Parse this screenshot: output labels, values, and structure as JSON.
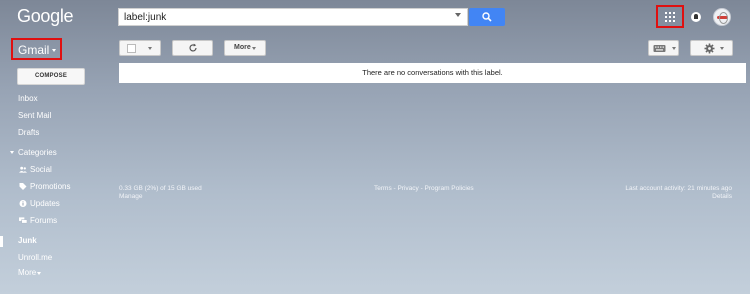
{
  "header": {
    "logo": "Google",
    "search": {
      "value": "label:junk"
    }
  },
  "app_switcher_label": "Gmail",
  "toolbar": {
    "more_label": "More"
  },
  "compose_label": "COMPOSE",
  "sidebar": {
    "items": [
      {
        "label": "Inbox"
      },
      {
        "label": "Sent Mail"
      },
      {
        "label": "Drafts"
      },
      {
        "label": "Categories"
      },
      {
        "label": "Social"
      },
      {
        "label": "Promotions"
      },
      {
        "label": "Updates"
      },
      {
        "label": "Forums"
      },
      {
        "label": "Junk"
      },
      {
        "label": "Unroll.me"
      },
      {
        "label": "More"
      }
    ]
  },
  "main": {
    "empty_message": "There are no conversations with this label."
  },
  "footer": {
    "storage": "0.33 GB (2%) of 15 GB used",
    "manage": "Manage",
    "links": "Terms - Privacy - Program Policies",
    "last_activity": "Last account activity: 21 minutes ago",
    "details": "Details"
  },
  "colors": {
    "search_button": "#4285f4",
    "highlight_border": "#e01010"
  }
}
